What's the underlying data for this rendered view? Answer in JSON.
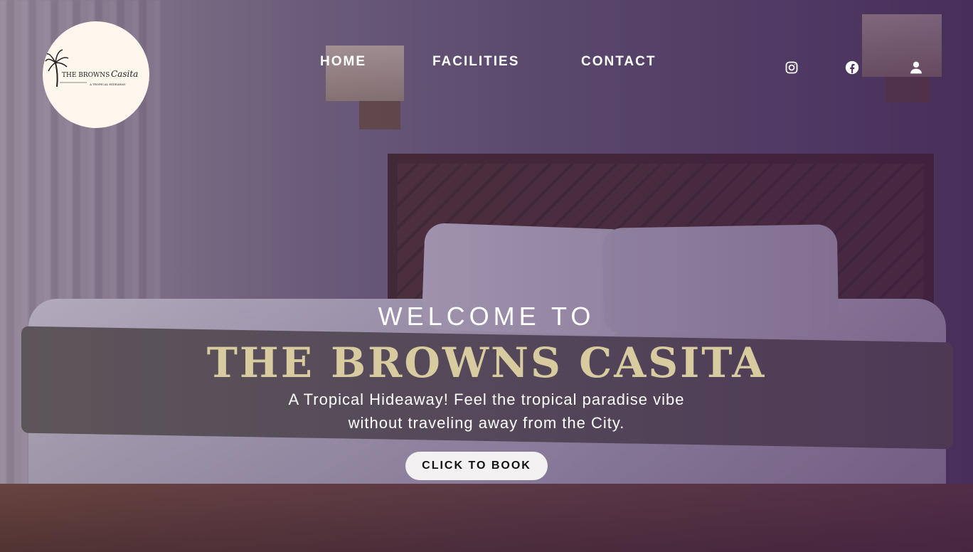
{
  "logo": {
    "brand_main": "THE BROWNS",
    "brand_script": "Casita",
    "tagline": "A TROPICAL HIDEAWAY"
  },
  "nav": {
    "items": [
      {
        "label": "HOME"
      },
      {
        "label": "FACILITIES"
      },
      {
        "label": "CONTACT"
      }
    ]
  },
  "header_icons": [
    "instagram-icon",
    "facebook-icon",
    "user-icon"
  ],
  "hero": {
    "welcome": "WELCOME TO",
    "title": "THE BROWNS CASITA",
    "tagline_line1": "A Tropical Hideaway! Feel the tropical paradise vibe",
    "tagline_line2": "without traveling away from the City.",
    "cta_label": "CLICK TO BOOK"
  },
  "colors": {
    "title_gold": "#d8cba0",
    "overlay_purple": "#3a1950",
    "logo_bg": "#fdf7ee",
    "button_bg": "#f3f1f2"
  }
}
